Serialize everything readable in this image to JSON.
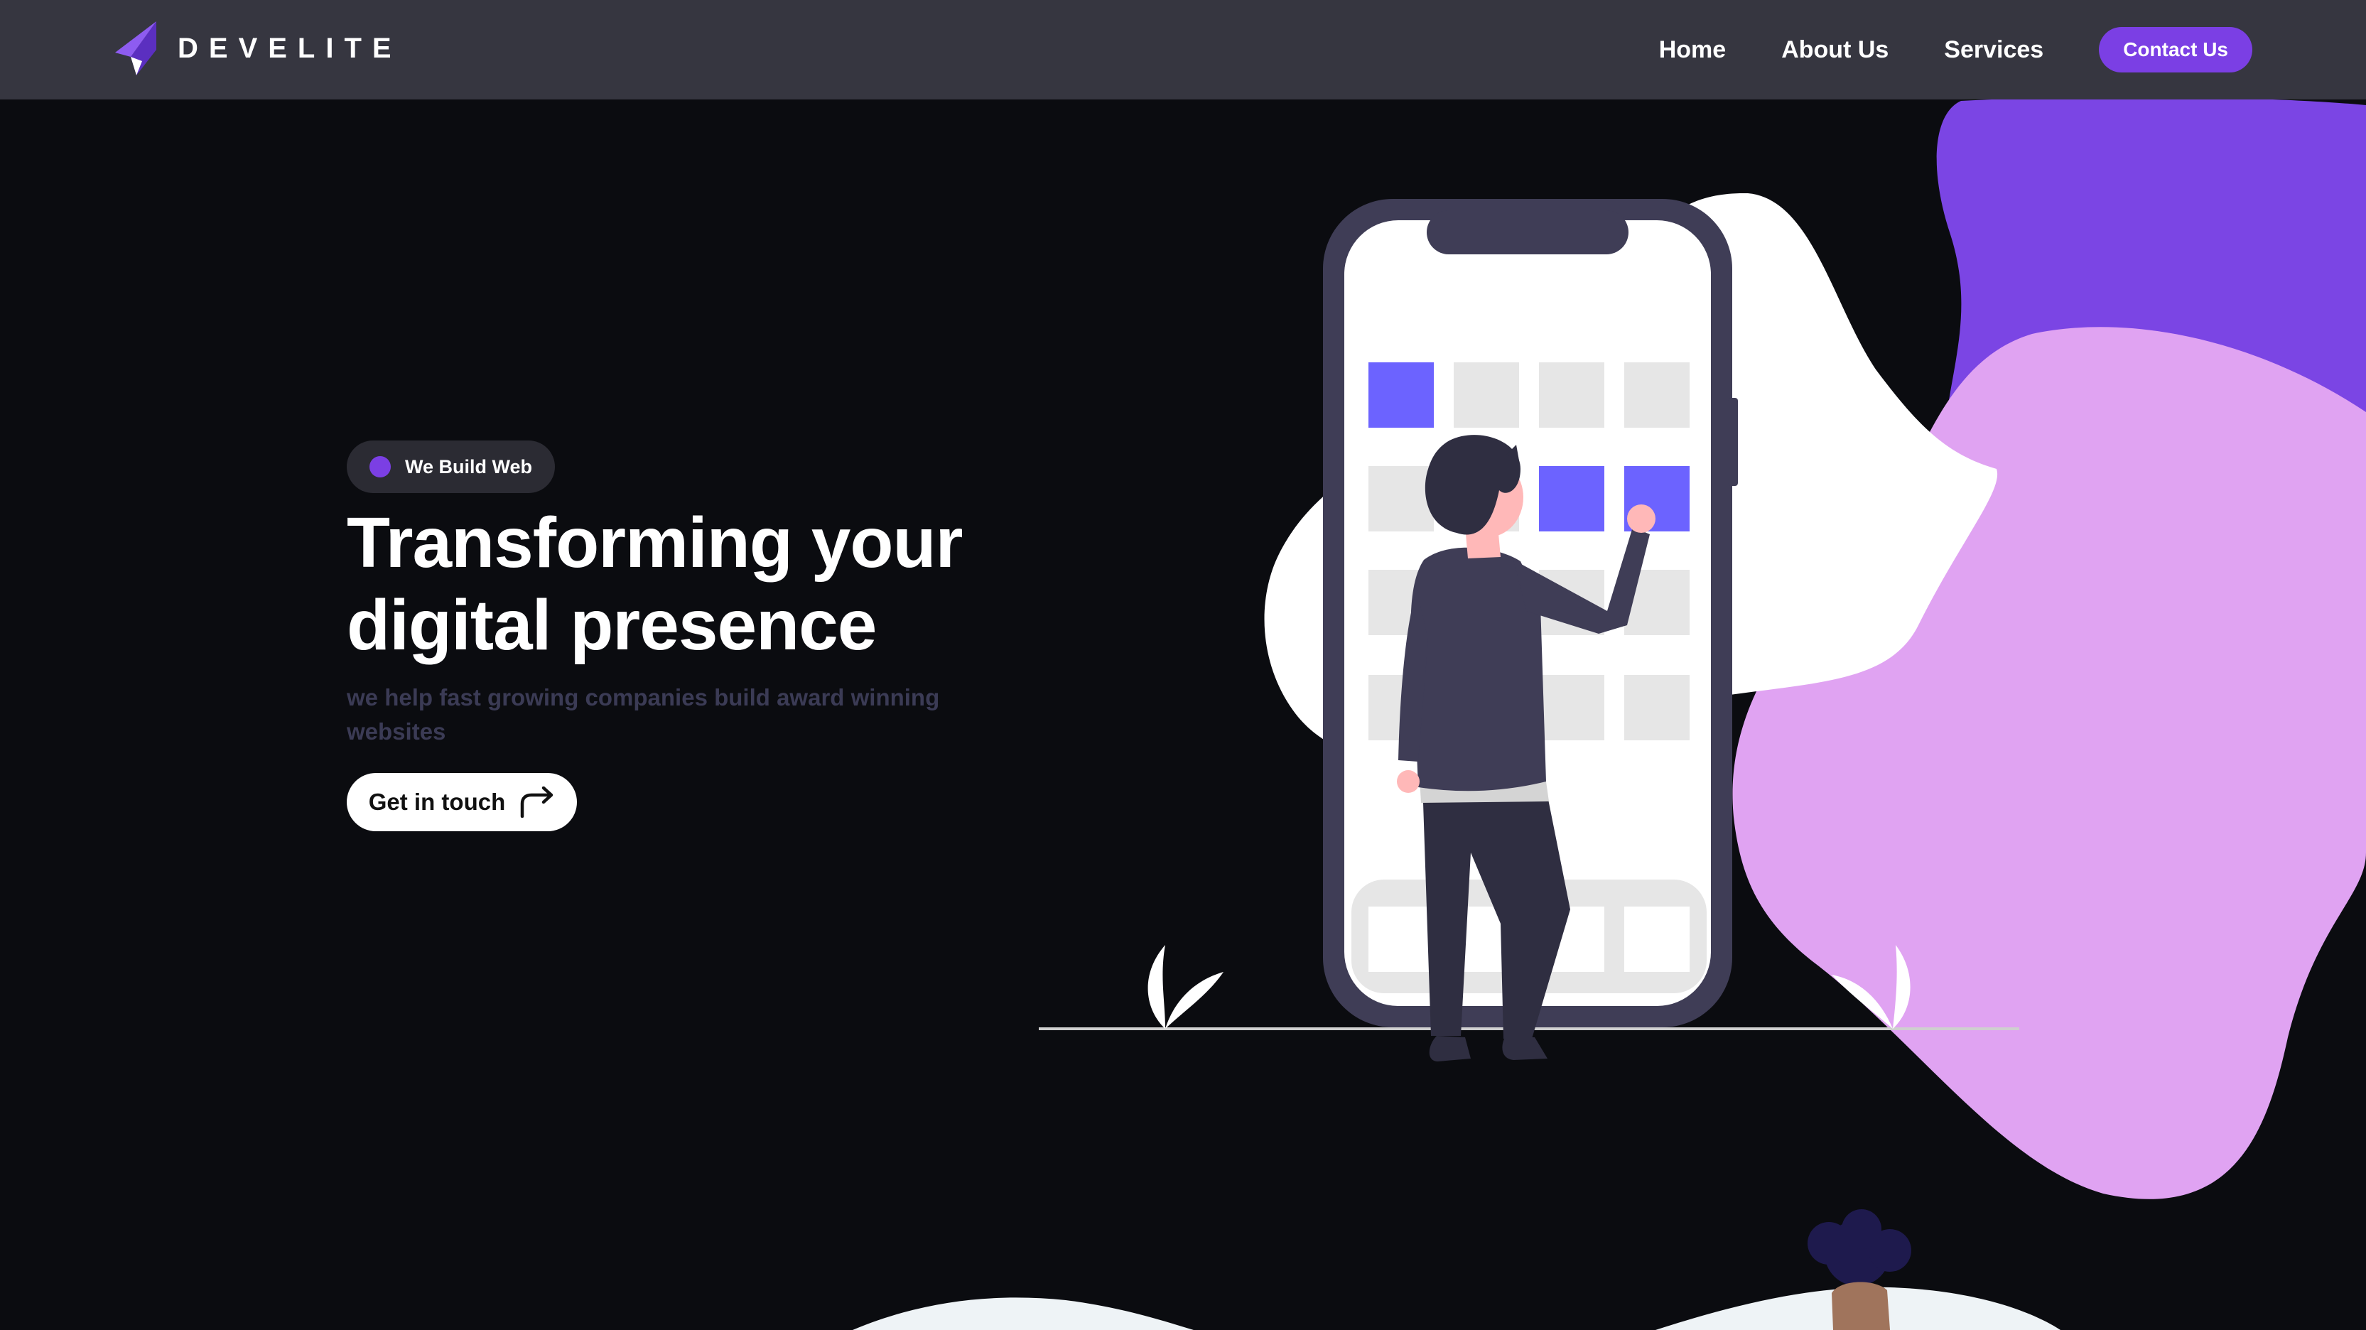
{
  "brand": {
    "name": "DEVELITE",
    "logo_icon": "paper-plane-icon",
    "accent": "#7b3fe4"
  },
  "nav": {
    "links": [
      "Home",
      "About Us",
      "Services"
    ],
    "contact_label": "Contact Us"
  },
  "hero": {
    "badge_label": "We Build Web",
    "title_line1": "Transforming your",
    "title_line2": "digital presence",
    "subtitle": "we help fast growing companies build award winning websites",
    "cta_label": "Get in touch",
    "cta_icon": "arrow-turn-right-icon"
  },
  "colors": {
    "background": "#0b0c10",
    "navbar": "#363640",
    "purple_dark": "#7b45e4",
    "purple_light": "#e0a3f2",
    "phone_frame": "#3f3d56",
    "tile_active": "#6c63ff",
    "tile_idle": "#e6e6e6"
  }
}
